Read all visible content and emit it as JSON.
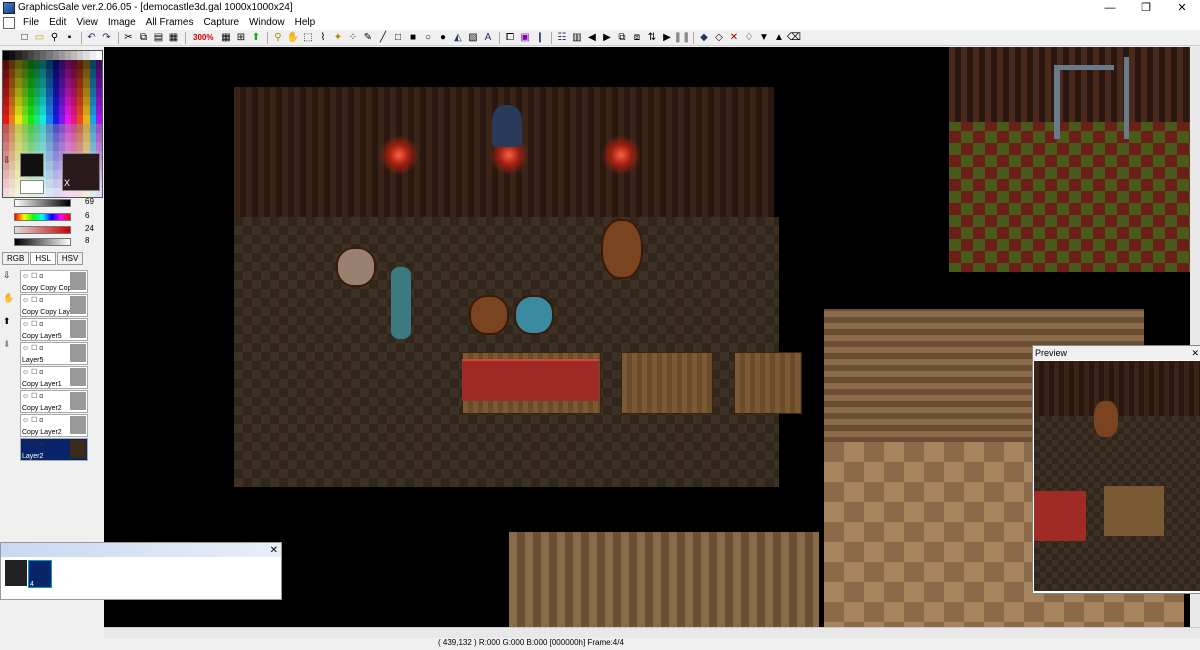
{
  "window": {
    "title": "GraphicsGale ver.2.06.05 - [democastle3d.gal 1000x1000x24]",
    "minimize": "—",
    "maximize": "❐",
    "close": "✕"
  },
  "menu": [
    "File",
    "Edit",
    "View",
    "Image",
    "All Frames",
    "Capture",
    "Window",
    "Help"
  ],
  "toolbar": {
    "zoom": "300%",
    "icons": [
      "new-icon",
      "open-icon",
      "search-icon",
      "save-icon",
      "undo-icon",
      "redo-icon",
      "cut-icon",
      "copy-icon",
      "paste-icon",
      "layers-icon",
      "grid-icon",
      "fit-icon",
      "green-arrow-icon",
      "zoom-icon",
      "hand-icon",
      "select-rect-icon",
      "lasso-icon",
      "magic-wand-icon",
      "spray-icon",
      "pen-icon",
      "line-icon",
      "rect-icon",
      "filled-rect-icon",
      "circle-icon",
      "filled-circle-icon",
      "fill-icon",
      "gradient-icon",
      "text-icon",
      "frame-icon",
      "mask-icon",
      "eyedropper-icon",
      "frames-icon",
      "pages-icon",
      "prev-icon",
      "next-icon",
      "copy-frame-icon",
      "paste-frame-icon",
      "play-icon",
      "pause-icon",
      "sort-icon",
      "checker-icon",
      "palette-icon",
      "flip-icon",
      "down-icon",
      "up-icon",
      "eraser-icon"
    ]
  },
  "colors": {
    "fg": "#111111",
    "bg": "#2a1a1e",
    "bg_label": "X"
  },
  "sliders": [
    {
      "value": "69"
    },
    {
      "value": "6"
    },
    {
      "value": "24"
    },
    {
      "value": "8"
    }
  ],
  "color_tabs": [
    "RGB",
    "HSL",
    "HSV"
  ],
  "layers": [
    {
      "names": [
        "Copy",
        "Copy",
        "Cop"
      ]
    },
    {
      "names": [
        "Copy",
        "Copy",
        "Lay"
      ]
    },
    {
      "names": [
        "Copy",
        "Layer5"
      ]
    },
    {
      "names": [
        "Layer5"
      ]
    },
    {
      "names": [
        "Copy",
        "Layer1"
      ]
    },
    {
      "names": [
        "Copy",
        "Layer2"
      ]
    },
    {
      "names": [
        "Copy",
        "Layer2"
      ]
    },
    {
      "names": [
        "Layer2"
      ]
    }
  ],
  "layer_icon": "α",
  "preview": {
    "title": "Preview",
    "close": "✕"
  },
  "frames": {
    "close": "✕",
    "selected_index": "4"
  },
  "status": {
    "text": "( 439,132 ) R:000 G:000 B:000  [000000h]  Frame:4/4"
  }
}
